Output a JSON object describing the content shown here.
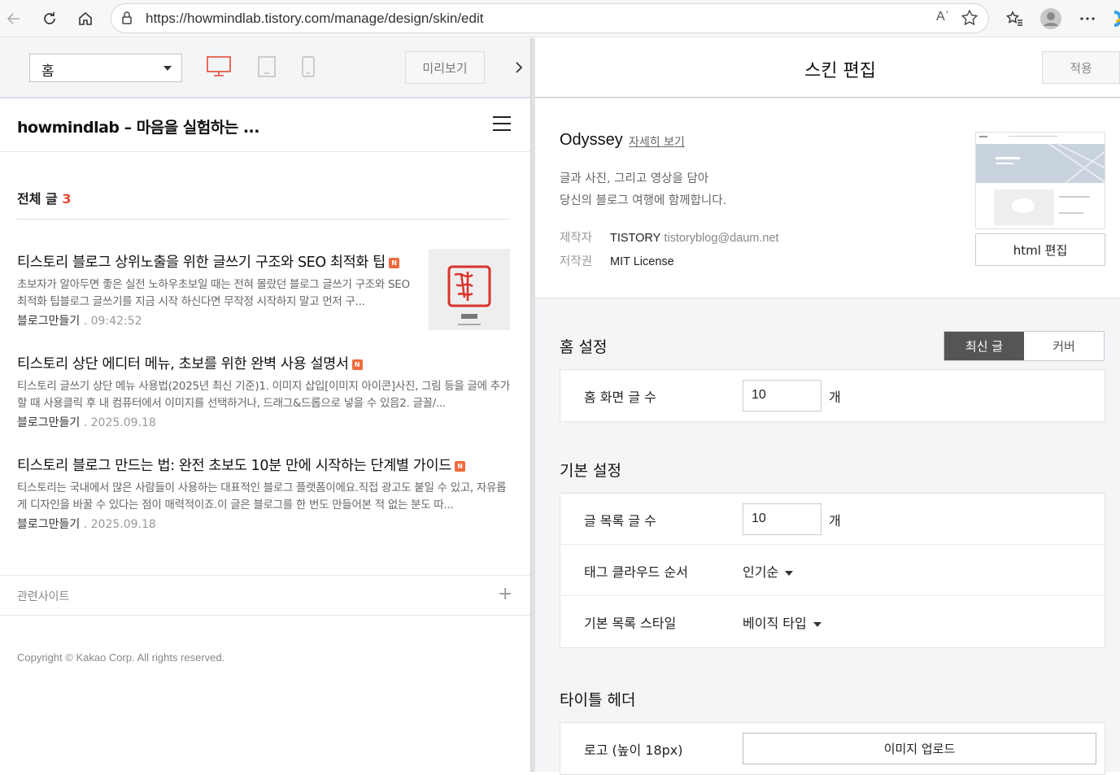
{
  "browser": {
    "url": "https://howmindlab.tistory.com/manage/design/skin/edit",
    "read_aloud": "Aʾ"
  },
  "preview": {
    "page_select": "홈",
    "preview_button": "미리보기",
    "blog_title": "howmindlab – 마음을 실험하는 ...",
    "total_label": "전체 글",
    "total_count": "3",
    "posts": [
      {
        "title": "티스토리 블로그 상위노출을 위한 글쓰기 구조와 SEO 최적화 팁",
        "badge": "N",
        "summary": "초보자가 알아두면 좋은 실전 노하우초보일 때는 전혀 몰랐던 블로그 글쓰기 구조와 SEO 최적화 팁블로그 글쓰기를 지금 시작 하신다면 무작정 시작하지 말고 먼저 구...",
        "category": "블로그만들기",
        "sep": ".",
        "time": "09:42:52"
      },
      {
        "title": "티스토리 상단 에디터 메뉴, 초보를 위한 완벽 사용 설명서",
        "badge": "N",
        "summary": "티스토리 글쓰기 상단 메뉴 사용법(2025년 최신 기준)1. 이미지 삽입[이미지 아이콘]사진, 그림 등을 글에 추가할 때 사용클릭 후 내 컴퓨터에서 이미지를 선택하거나, 드래그&드롭으로 넣을 수 있음2. 글꼴/...",
        "category": "블로그만들기",
        "sep": ".",
        "time": "2025.09.18"
      },
      {
        "title": "티스토리 블로그 만드는 법: 완전 초보도 10분 만에 시작하는 단계별 가이드",
        "badge": "N",
        "summary": "티스토리는 국내에서 많은 사람들이 사용하는 대표적인 블로그 플랫폼이에요.직접 광고도 붙일 수 있고, 자유롭게 디자인을 바꿀 수 있다는 점이 매력적이죠.이 글은 블로그를 한 번도 만들어본 적 없는 분도 따...",
        "category": "블로그만들기",
        "sep": ".",
        "time": "2025.09.18"
      }
    ],
    "related_label": "관련사이트",
    "copyright": "Copyright © Kakao Corp. All rights reserved."
  },
  "editor": {
    "title": "스킨 편집",
    "apply_button": "적용",
    "skin_name": "Odyssey",
    "detail_link": "자세히 보기",
    "desc_line1": "글과 사진, 그리고 영상을 담아",
    "desc_line2": "당신의 블로그 여행에 함께합니다.",
    "maker_label": "제작자",
    "maker_value": "TISTORY",
    "maker_email": "tistoryblog@daum.net",
    "license_label": "저작권",
    "license_value": "MIT License",
    "html_edit_button": "html 편집",
    "home_settings": {
      "title": "홈 설정",
      "tab_latest": "최신 글",
      "tab_cover": "커버",
      "post_count_label": "홈 화면 글 수",
      "post_count_value": "10",
      "unit": "개"
    },
    "basic_settings": {
      "title": "기본 설정",
      "list_count_label": "글 목록 글 수",
      "list_count_value": "10",
      "unit": "개",
      "tag_order_label": "태그 클라우드 순서",
      "tag_order_value": "인기순",
      "list_style_label": "기본 목록 스타일",
      "list_style_value": "베이직 타입"
    },
    "title_header": {
      "title": "타이틀 헤더",
      "logo_label": "로고 (높이 18px)",
      "upload_button": "이미지 업로드"
    }
  }
}
